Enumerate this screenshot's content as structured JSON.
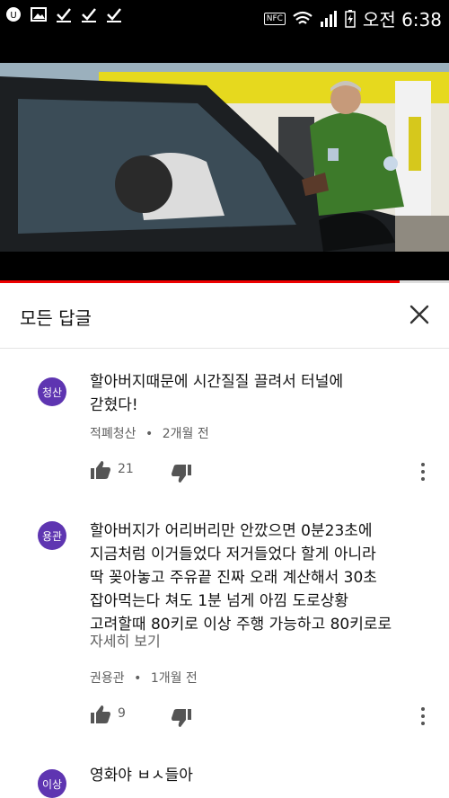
{
  "status_bar": {
    "time": "오전 6:38",
    "nfc": "NFC"
  },
  "comments_panel": {
    "title": "모든 답글"
  },
  "comments": [
    {
      "avatar_text": "청산",
      "text_lines": [
        "할아버지때문에 시간질질 끌려서 터널에",
        "갇혔다!"
      ],
      "author": "적폐청산",
      "time": "2개월 전",
      "likes": "21"
    },
    {
      "avatar_text": "용관",
      "text_lines": [
        "할아버지가 어리버리만 안깠으면 0분23초에",
        "지금처럼 이거들었다 저거들었다 할게 아니라",
        "딱 꽂아놓고 주유끝 진짜 오래 계산해서 30초",
        "잡아먹는다 쳐도 1분 넘게 아낌 도로상황",
        "고려할때 80키로 이상 주행 가능하고 80키로로"
      ],
      "read_more": "자세히 보기",
      "author": "권용관",
      "time": "1개월 전",
      "likes": "9"
    },
    {
      "avatar_text": "이상",
      "text_lines": [
        "영화야 ㅂㅅ들아"
      ]
    }
  ],
  "meta_separator": "•",
  "video": {
    "progress": 0.89
  },
  "colors": {
    "avatar_bg": "#5e35b1",
    "progress": "#ee0000"
  }
}
